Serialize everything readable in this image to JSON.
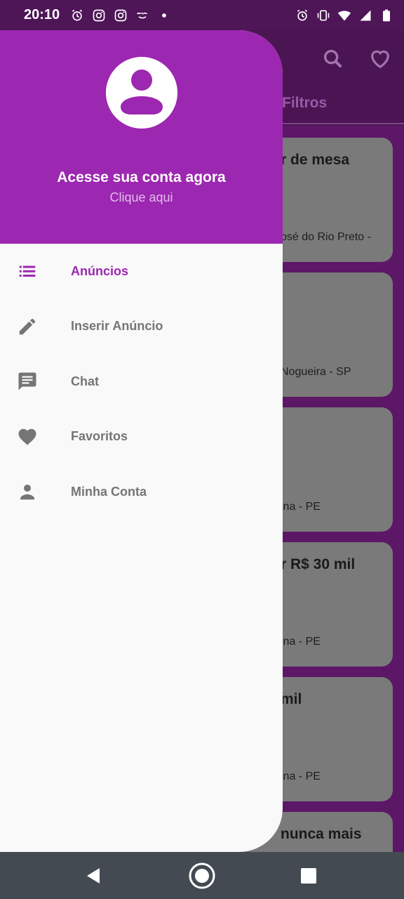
{
  "status_bar": {
    "time": "20:10",
    "left_icons": [
      "alarm-icon",
      "instagram-icon",
      "instagram-icon",
      "ifood-icon",
      "dot-icon"
    ],
    "right_icons": [
      "alarm-icon",
      "vibrate-icon",
      "wifi-icon",
      "signal-icon",
      "battery-icon"
    ]
  },
  "background_app": {
    "filters_tab": "Filtros",
    "action_icons": [
      "search-icon",
      "heart-outline-icon"
    ],
    "cards": [
      {
        "title": "r de mesa",
        "location": "osé do Rio Preto -"
      },
      {
        "title": "",
        "location": "Nogueira - SP"
      },
      {
        "title": "",
        "location": "ina - PE"
      },
      {
        "title": "r R$ 30 mil",
        "location": "ina - PE"
      },
      {
        "title": "mil",
        "location": "ina - PE"
      },
      {
        "title": "nunca mais",
        "location": ""
      }
    ]
  },
  "drawer": {
    "header": {
      "title": "Acesse sua conta agora",
      "subtitle": "Clique aqui",
      "avatar_icon": "account-circle-icon"
    },
    "items": [
      {
        "label": "Anúncios",
        "icon": "list-icon",
        "active": true
      },
      {
        "label": "Inserir Anúncio",
        "icon": "pencil-icon",
        "active": false
      },
      {
        "label": "Chat",
        "icon": "chat-icon",
        "active": false
      },
      {
        "label": "Favoritos",
        "icon": "heart-icon",
        "active": false
      },
      {
        "label": "Minha Conta",
        "icon": "person-icon",
        "active": false
      }
    ]
  },
  "nav_bar": {
    "buttons": [
      "back-icon",
      "home-icon",
      "recents-icon"
    ]
  },
  "colors": {
    "primary": "#9c27b0",
    "header_subtitle": "#e3bdec",
    "inactive_item": "#757575",
    "drawer_bg": "#f9f9f9",
    "scrim_bg": "#4a1552",
    "nav_bar": "#434a51"
  }
}
